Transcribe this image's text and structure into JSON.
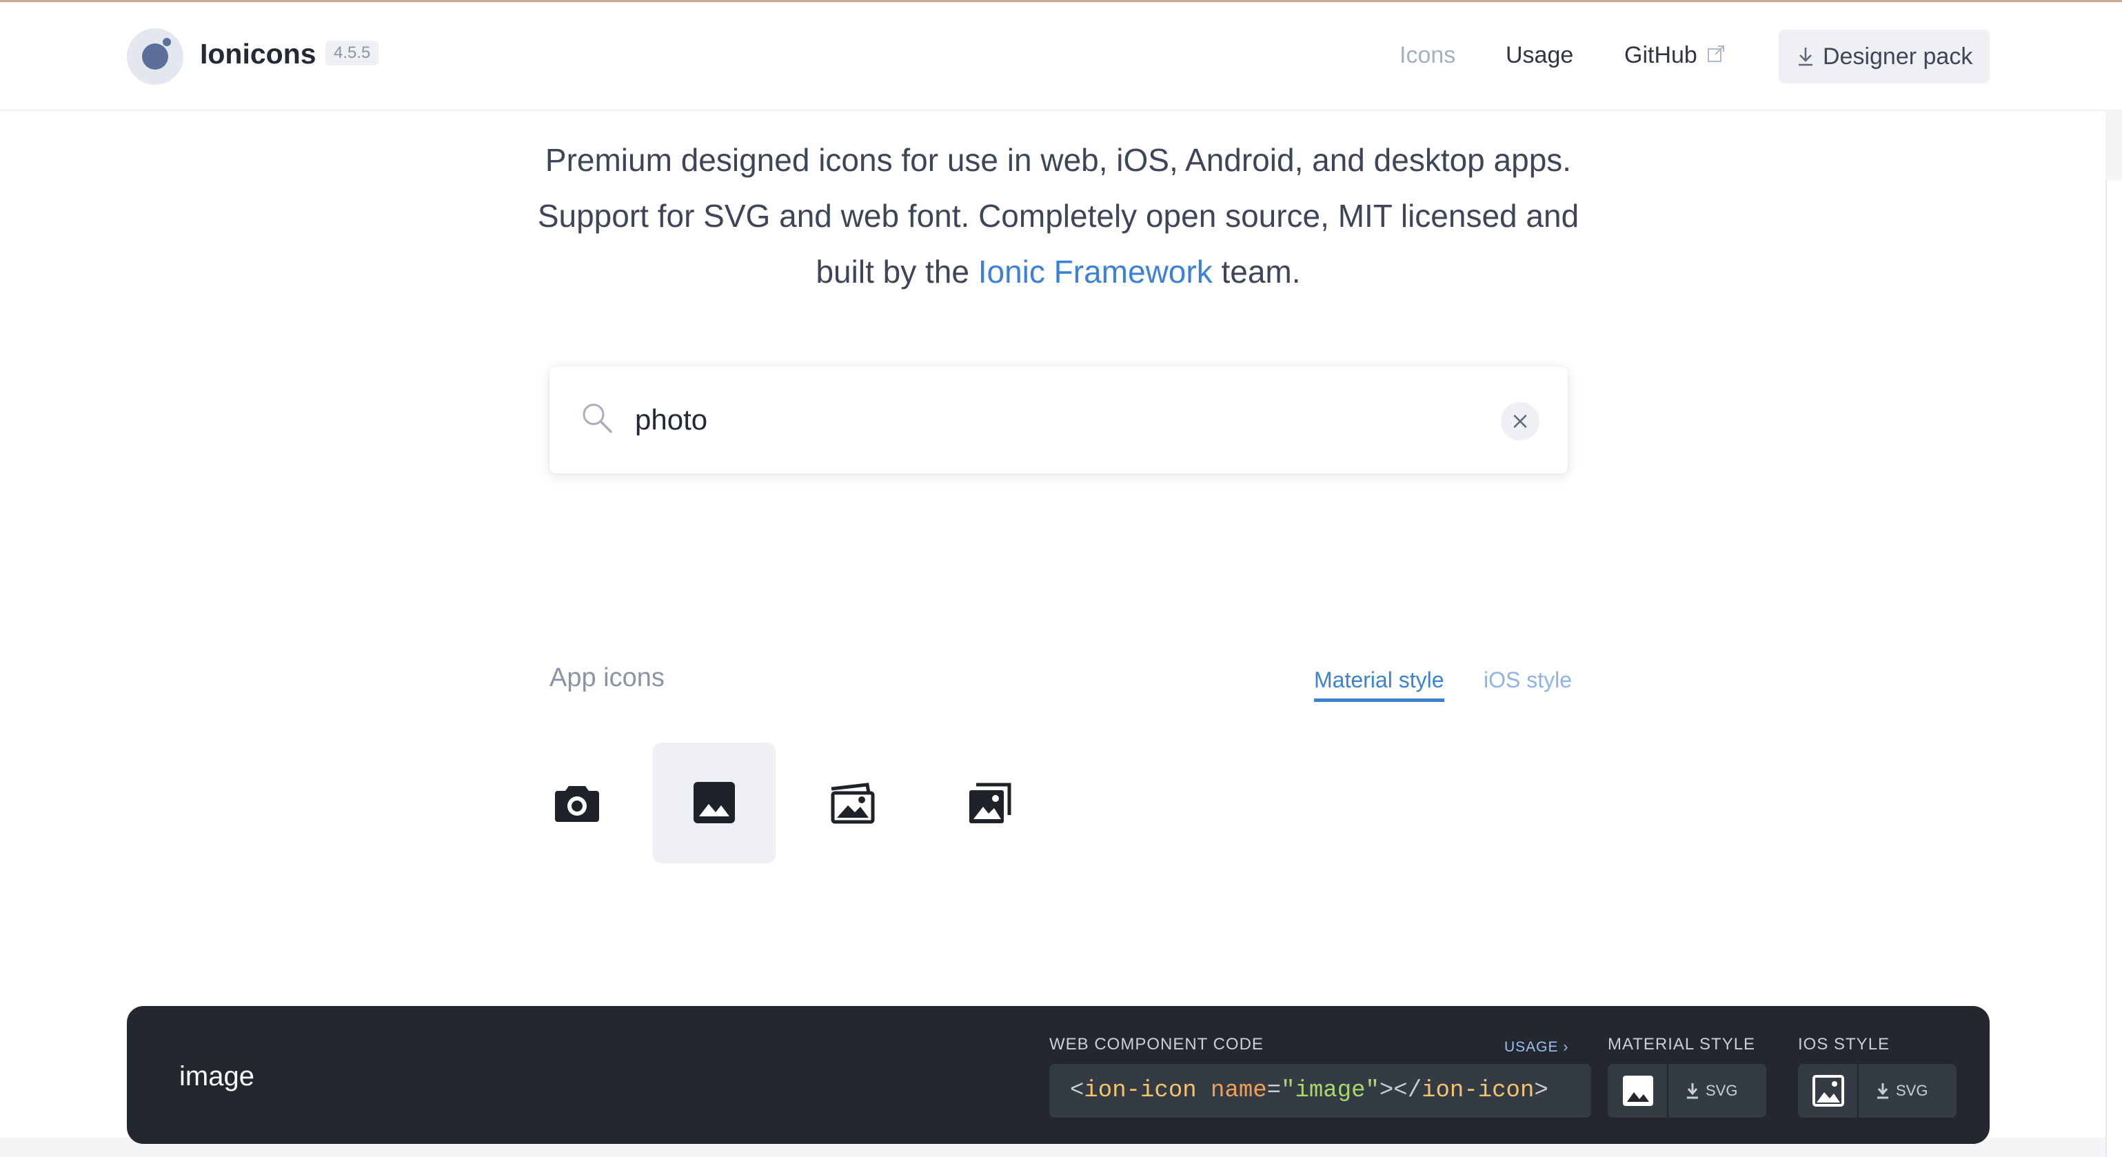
{
  "header": {
    "brand": "Ionicons",
    "version": "4.5.5",
    "nav": {
      "icons": "Icons",
      "usage": "Usage",
      "github": "GitHub"
    },
    "designer_pack": "Designer pack"
  },
  "tagline": {
    "line1": "Premium designed icons for use in web, iOS, Android, and desktop apps.",
    "line2": "Support for SVG and web font. Completely open source, MIT licensed and",
    "line3_before": "built by the",
    "line3_link": "Ionic Framework",
    "line3_after": "team."
  },
  "search": {
    "value": "photo"
  },
  "section": {
    "title": "App icons",
    "tabs": {
      "material": "Material style",
      "ios": "iOS style"
    },
    "active_tab": "material",
    "icons": [
      {
        "icon": "camera-icon"
      },
      {
        "icon": "image-icon",
        "selected": true
      },
      {
        "icon": "images-icon"
      },
      {
        "icon": "photos-icon"
      }
    ]
  },
  "detail": {
    "name": "image",
    "code_label": "WEB COMPONENT CODE",
    "usage_link": "USAGE ›",
    "material_label": "MATERIAL STYLE",
    "ios_label": "IOS STYLE",
    "code": {
      "open": "<",
      "tag": "ion-icon",
      "attr": "name",
      "eq": "=",
      "value": "\"image\"",
      "close_mid": "></",
      "tag_end": "ion-icon",
      "close": ">"
    },
    "svg_label": "SVG"
  },
  "colors": {
    "accent": "#3b82d6",
    "panel_bg": "#23272e",
    "selected_bg": "#eef0f4"
  }
}
